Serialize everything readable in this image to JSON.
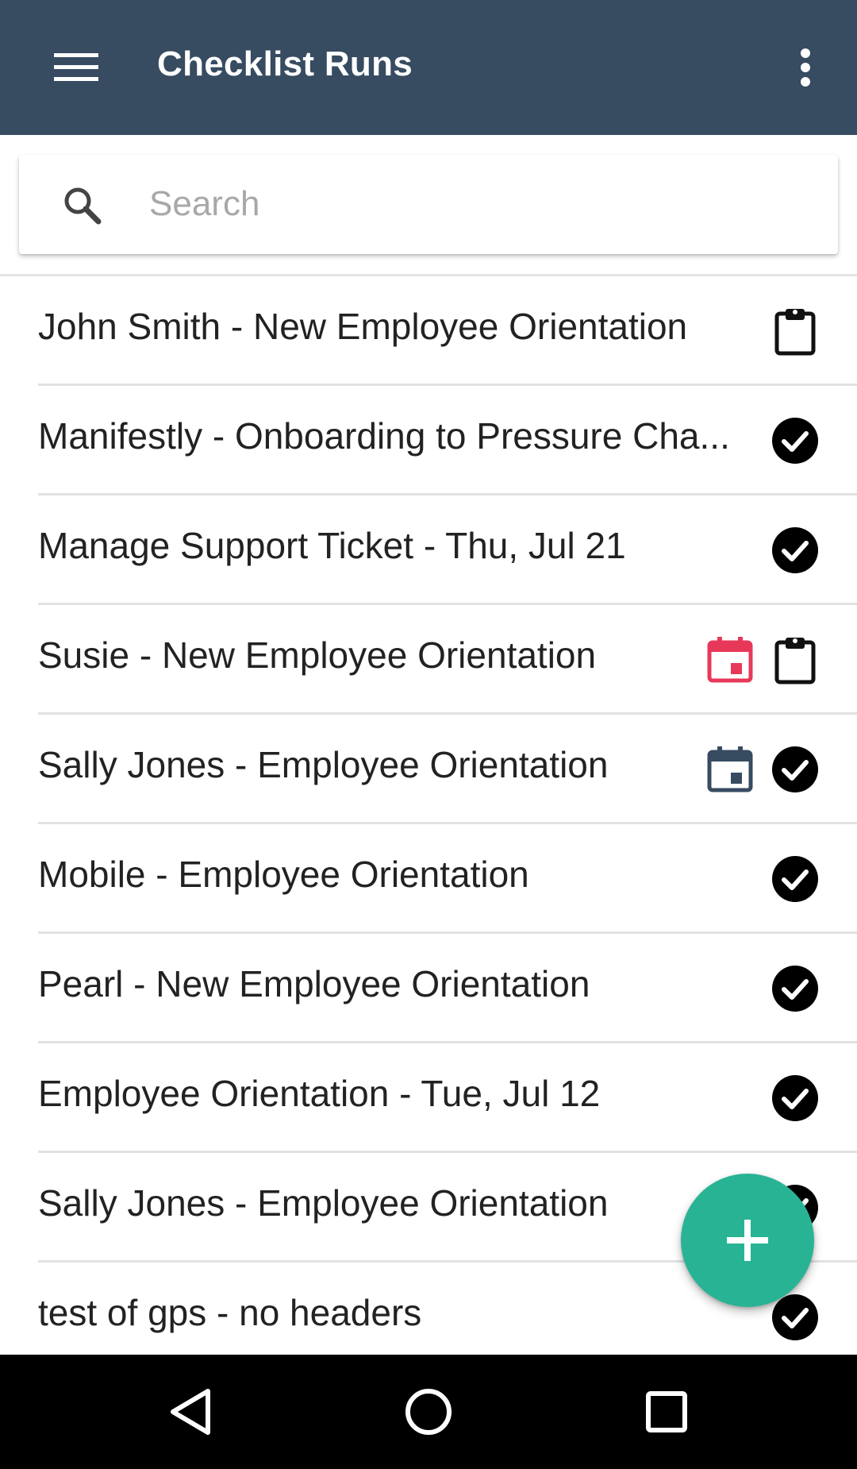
{
  "appbar": {
    "title": "Checklist Runs",
    "menu_icon": "hamburger-menu-icon",
    "more_icon": "more-vertical-icon",
    "color": "#374b61"
  },
  "search": {
    "placeholder": "Search",
    "value": "",
    "icon": "search-icon"
  },
  "runs": [
    {
      "label": "John Smith - New Employee Orientation",
      "icons": [
        "clipboard-icon"
      ]
    },
    {
      "label": "Manifestly - Onboarding to Pressure Cha...",
      "icons": [
        "check-circle-icon"
      ]
    },
    {
      "label": "Manage Support Ticket - Thu, Jul 21",
      "icons": [
        "check-circle-icon"
      ]
    },
    {
      "label": "Susie - New Employee Orientation",
      "icons": [
        "calendar-overdue-icon",
        "clipboard-icon"
      ]
    },
    {
      "label": "Sally Jones - Employee Orientation",
      "icons": [
        "calendar-icon",
        "check-circle-icon"
      ]
    },
    {
      "label": "Mobile - Employee Orientation",
      "icons": [
        "check-circle-icon"
      ]
    },
    {
      "label": "Pearl - New Employee Orientation",
      "icons": [
        "check-circle-icon"
      ]
    },
    {
      "label": "Employee Orientation - Tue, Jul 12",
      "icons": [
        "check-circle-icon"
      ]
    },
    {
      "label": "Sally Jones - Employee Orientation",
      "icons": [
        "check-circle-icon"
      ]
    },
    {
      "label": "test of gps - no headers",
      "icons": [
        "check-circle-icon"
      ]
    }
  ],
  "colors": {
    "overdue_calendar": "#e8385a",
    "calendar": "#374b61",
    "fab": "#28b494"
  },
  "fab": {
    "icon": "plus-icon"
  },
  "system_nav": {
    "back_icon": "back-triangle-icon",
    "home_icon": "home-circle-icon",
    "recents_icon": "recents-square-icon"
  }
}
